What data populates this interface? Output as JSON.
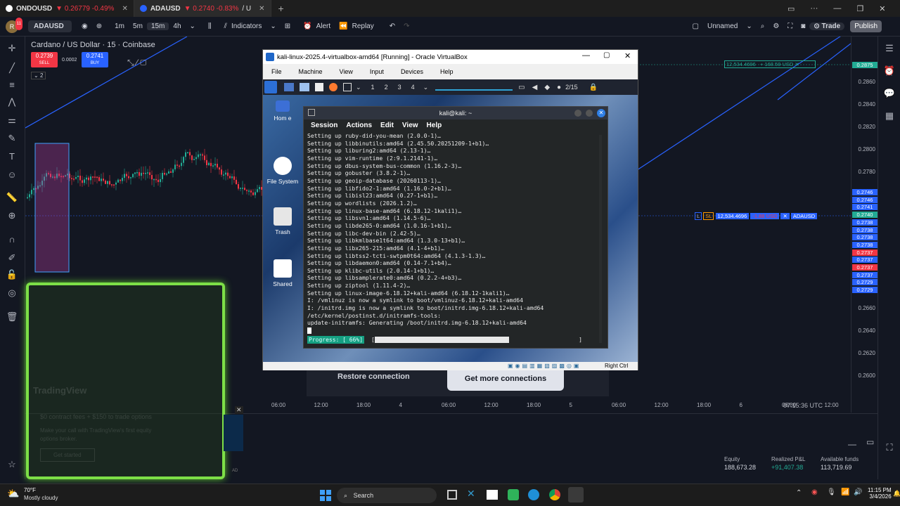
{
  "browser": {
    "tabs": [
      {
        "symbol": "ONDOUSD",
        "price": "0.26779",
        "change": "-0.49%",
        "active": false
      },
      {
        "symbol": "ADAUSD",
        "price": "0.2740",
        "change": "-0.83%",
        "suffix": "/ U",
        "active": true
      }
    ],
    "new_tab": "+"
  },
  "toolbar": {
    "symbol": "ADAUSD",
    "intervals": [
      "1m",
      "5m",
      "15m",
      "4h"
    ],
    "indicators": "Indicators",
    "alert": "Alert",
    "replay": "Replay",
    "layout": "Unnamed",
    "trade": "Trade",
    "publish": "Publish"
  },
  "chart": {
    "title": "Cardano / US Dollar · 15 · Coinbase",
    "sell_price": "0.2739",
    "sell_label": "SELL",
    "spread": "0.0002",
    "buy_price": "0.2741",
    "buy_label": "BUY",
    "indicator_count": "2",
    "price_labels": [
      "0.2875",
      "0.2860",
      "0.2840",
      "0.2820",
      "0.2800",
      "0.2780",
      "0.2660",
      "0.2640",
      "0.2620",
      "0.2600"
    ],
    "price_tags": [
      "0.2746",
      "0.2746",
      "0.2741",
      "0.2740",
      "0.2738",
      "0.2738",
      "0.2738",
      "0.2738",
      "0.2737",
      "0.2737",
      "0.2737",
      "0.2737",
      "0.2729",
      "0.2729"
    ],
    "position_top": {
      "qty": "12,534.4696",
      "pnl": "+ 168.59 USD"
    },
    "position_mid": {
      "sl": "SL",
      "qty": "12,534.4696",
      "pnl": "-1.88 USD",
      "symbol": "ADAUSD"
    },
    "time_labels": [
      "06:00",
      "12:00",
      "18:00",
      "4",
      "06:00",
      "12:00",
      "18:00",
      "5",
      "06:00",
      "12:00",
      "18:00",
      "6",
      "06:00",
      "12:00"
    ],
    "clock": "07:15:36 UTC"
  },
  "account": {
    "equity_label": "Equity",
    "equity": "188,673.28",
    "pnl_label": "Realized P&L",
    "pnl": "+91,407.38",
    "funds_label": "Available funds",
    "funds": "113,719.69"
  },
  "vbox": {
    "title": "kali-linux-2025.4-virtualbox-amd64 [Running] - Oracle VirtualBox",
    "menu": [
      "File",
      "Machine",
      "View",
      "Input",
      "Devices",
      "Help"
    ],
    "workspaces": [
      "1",
      "2",
      "3",
      "4"
    ],
    "clock": "2/15",
    "host_key": "Right Ctrl",
    "desktop_icons": [
      "Hom e",
      "File System",
      "Trash",
      "Shared"
    ]
  },
  "terminal": {
    "title": "kali@kali: ~",
    "menu": [
      "Session",
      "Actions",
      "Edit",
      "View",
      "Help"
    ],
    "lines": [
      "Setting up ruby-did-you-mean (2.0.0-1)…",
      "Setting up libbinutils:amd64 (2.45.50.20251209-1+b1)…",
      "Setting up liburing2:amd64 (2.13-1)…",
      "Setting up vim-runtime (2:9.1.2141-1)…",
      "Setting up dbus-system-bus-common (1.16.2-3)…",
      "Setting up gobuster (3.8.2-1)…",
      "Setting up geoip-database (20260113-1)…",
      "Setting up libfido2-1:amd64 (1.16.0-2+b1)…",
      "Setting up libisl23:amd64 (0.27-1+b1)…",
      "Setting up wordlists (2026.1.2)…",
      "Setting up linux-base-amd64 (6.18.12-1kali1)…",
      "Setting up libsvn1:amd64 (1.14.5-6)…",
      "Setting up libde265-0:amd64 (1.0.16-1+b1)…",
      "Setting up libc-dev-bin (2.42-5)…",
      "Setting up libkmlbase1t64:amd64 (1.3.0-13+b1)…",
      "Setting up libx265-215:amd64 (4.1-4+b1)…",
      "Setting up libtss2-tcti-swtpm0t64:amd64 (4.1.3-1.3)…",
      "Setting up libdaemon0:amd64 (0.14-7.1+b4)…",
      "Setting up klibc-utils (2.0.14-1+b1)…",
      "Setting up libsamplerate0:amd64 (0.2.2-4+b3)…",
      "Setting up ziptool (1.11.4-2)…",
      "Setting up linux-image-6.18.12+kali-amd64 (6.18.12-1kali1)…",
      "I: /vmlinuz is now a symlink to boot/vmlinuz-6.18.12+kali-amd64",
      "I: /initrd.img is now a symlink to boot/initrd.img-6.18.12+kali-amd64",
      "/etc/kernel/postinst.d/initramfs-tools:",
      "update-initramfs: Generating /boot/initrd.img-6.18.12+kali-amd64"
    ],
    "progress_label": "Progress: [ 66%]",
    "progress_value": 0.66
  },
  "connection": {
    "restore": "Restore connection",
    "more": "Get more connections"
  },
  "promo": {
    "brand": "TradingView",
    "line1": "$0 contract fees + $150 to trade options",
    "line2": "Make your call with TradingView's first equity",
    "line3": "options broker.",
    "button": "Get started",
    "ad": "AD"
  },
  "taskbar": {
    "temp": "70°F",
    "weather": "Mostly cloudy",
    "search": "Search",
    "time": "11:15 PM",
    "date": "3/4/2026"
  },
  "colors": {
    "up": "#22ab94",
    "down": "#f23645",
    "accent": "#2962ff",
    "highlight": "#7ddf47"
  }
}
